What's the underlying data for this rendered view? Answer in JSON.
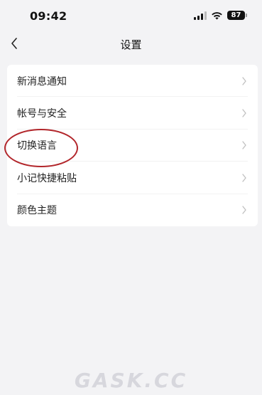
{
  "status_bar": {
    "time": "09:42",
    "battery": "87",
    "icons": [
      "signal-icon",
      "wifi-icon",
      "battery-icon"
    ]
  },
  "nav": {
    "title": "设置",
    "back_icon": "chevron-left-icon"
  },
  "settings": {
    "items": [
      {
        "label": "新消息通知",
        "icon": "chevron-right-icon"
      },
      {
        "label": "帐号与安全",
        "icon": "chevron-right-icon"
      },
      {
        "label": "切换语言",
        "icon": "chevron-right-icon",
        "highlighted": true
      },
      {
        "label": "小记快捷粘贴",
        "icon": "chevron-right-icon"
      },
      {
        "label": "颜色主题",
        "icon": "chevron-right-icon"
      }
    ]
  },
  "annotation": {
    "color": "#b2262b",
    "shape": "ellipse"
  },
  "watermark": "GASK.CC",
  "colors": {
    "background": "#f3f3f5",
    "card": "#ffffff",
    "chevron": "#c0c0c0"
  }
}
